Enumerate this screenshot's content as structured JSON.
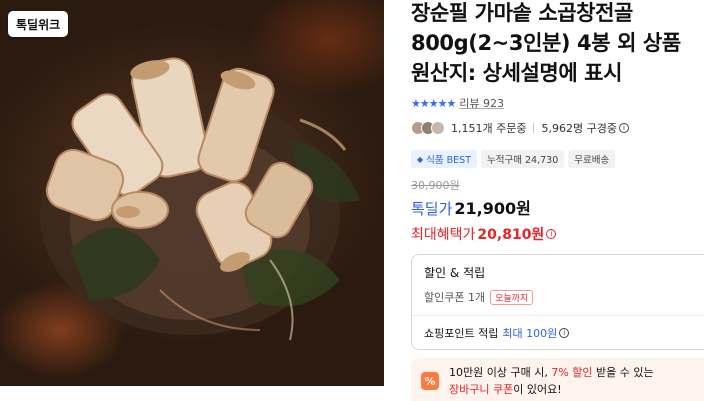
{
  "image": {
    "alt_icon": "product-photo",
    "brand_badge": "톡딜위크"
  },
  "product": {
    "title": "장순필 가마솥 소곱창전골\n800g(2~3인분) 4봉 외 상품\n원산지: 상세설명에 표시",
    "stars": "★★★★★",
    "rating_fraction": 0.9,
    "review_label": "리뷰 923",
    "orders": "1,151개 주문중",
    "viewers": "5,962명 구경중",
    "tags": [
      "식품 BEST",
      "누적구매 24,730",
      "무료배송"
    ],
    "best_icon": "diamond-icon"
  },
  "price": {
    "original": "30,900원",
    "deal_label": "톡딜가",
    "deal_price": "21,900원",
    "max_label": "최대혜택가",
    "max_price": "20,810원"
  },
  "benefits": {
    "title": "할인 & 적립",
    "coupon_label": "할인쿠폰 1개",
    "coupon_badge": "오늘까지",
    "point_label": "쇼핑포인트 적립",
    "point_value": "최대 100원"
  },
  "promo": {
    "icon": "percent-icon",
    "icon_glyph": "%",
    "line1_prefix": "10만원 이상 구매 시, ",
    "line1_highlight": "7% 할인",
    "line1_suffix": " 받을 수 있는",
    "line2_highlight": "장바구니 쿠폰",
    "line2_suffix": "이 있어요!"
  },
  "colors": {
    "accent_blue": "#2f63e8",
    "accent_red": "#e52528",
    "star_blue": "#346aff",
    "promo_orange": "#ff7a3c"
  }
}
